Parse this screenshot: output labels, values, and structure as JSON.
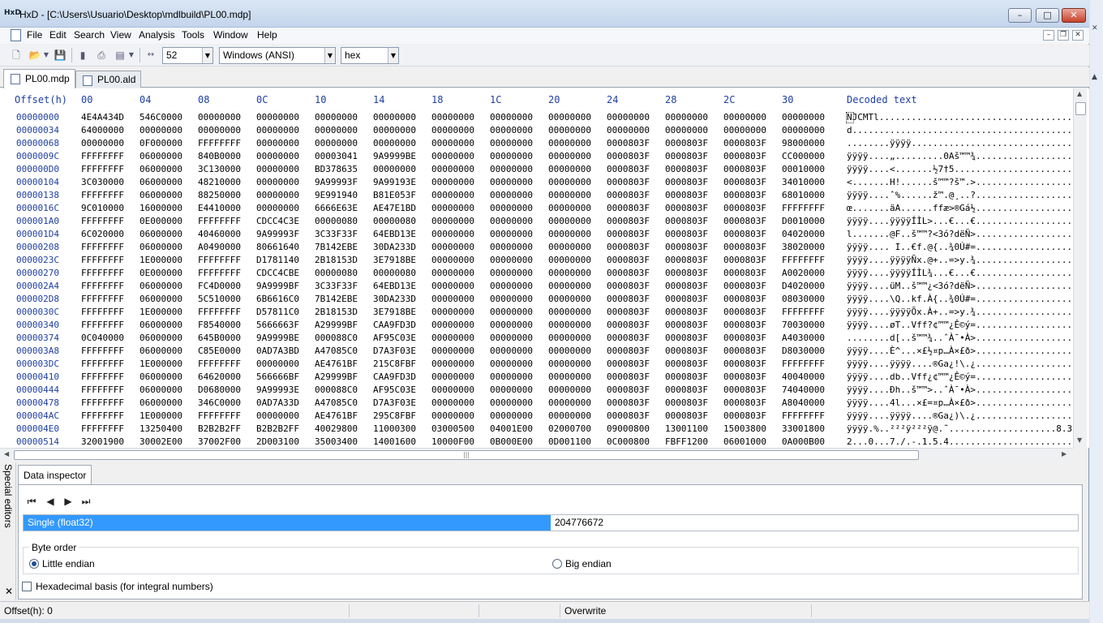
{
  "window": {
    "title": "HxD - [C:\\Users\\Usuario\\Desktop\\mdlbuild\\PL00.mdp]",
    "app_icon_text": "HxD"
  },
  "menubar": {
    "items": [
      "File",
      "Edit",
      "Search",
      "View",
      "Analysis",
      "Tools",
      "Window",
      "Help"
    ]
  },
  "toolbar": {
    "bytes_per_row": "52",
    "charset": "Windows (ANSI)",
    "display_mode": "hex"
  },
  "tabs": [
    {
      "label": "PL00.mdp",
      "active": true
    },
    {
      "label": "PL00.ald",
      "active": false
    }
  ],
  "hex_view": {
    "offset_header": "Offset(h)",
    "column_headers": [
      "00",
      "04",
      "08",
      "0C",
      "10",
      "14",
      "18",
      "1C",
      "20",
      "24",
      "28",
      "2C",
      "30"
    ],
    "decoded_header": "Decoded text",
    "rows": [
      {
        "offset": "00000000",
        "cells": [
          "4E4A434D",
          "546C0000",
          "00000000",
          "00000000",
          "00000000",
          "00000000",
          "00000000",
          "00000000",
          "00000000",
          "00000000",
          "00000000",
          "00000000",
          "00000000"
        ],
        "decoded": "NJCMTl......................................."
      },
      {
        "offset": "00000034",
        "cells": [
          "64000000",
          "00000000",
          "00000000",
          "00000000",
          "00000000",
          "00000000",
          "00000000",
          "00000000",
          "00000000",
          "00000000",
          "00000000",
          "00000000",
          "00000000"
        ],
        "decoded": "d............................................."
      },
      {
        "offset": "00000068",
        "cells": [
          "00000000",
          "0F000000",
          "FFFFFFFF",
          "00000000",
          "00000000",
          "00000000",
          "00000000",
          "00000000",
          "00000000",
          "0000803F",
          "0000803F",
          "0000803F",
          "98000000"
        ],
        "decoded": "........ÿÿÿÿ.................................."
      },
      {
        "offset": "0000009C",
        "cells": [
          "FFFFFFFF",
          "06000000",
          "840B0000",
          "00000000",
          "00003041",
          "9A9999BE",
          "00000000",
          "00000000",
          "00000000",
          "0000803F",
          "0000803F",
          "0000803F",
          "CC000000"
        ],
        "decoded": "ÿÿÿÿ....„.........0Aš™™¾........................"
      },
      {
        "offset": "000000D0",
        "cells": [
          "FFFFFFFF",
          "06000000",
          "3C130000",
          "00000000",
          "BD378635",
          "00000000",
          "00000000",
          "00000000",
          "00000000",
          "0000803F",
          "0000803F",
          "0000803F",
          "00010000"
        ],
        "decoded": "ÿÿÿÿ....<.......½7†5............................"
      },
      {
        "offset": "00000104",
        "cells": [
          "3C030000",
          "06000000",
          "48210000",
          "00000000",
          "9A99993F",
          "9A99193E",
          "00000000",
          "00000000",
          "00000000",
          "0000803F",
          "0000803F",
          "0000803F",
          "34010000"
        ],
        "decoded": "<.......H!......š™™?š™.>......................."
      },
      {
        "offset": "00000138",
        "cells": [
          "FFFFFFFF",
          "06000000",
          "88250000",
          "00000000",
          "9E991940",
          "B81E053F",
          "00000000",
          "00000000",
          "00000000",
          "0000803F",
          "0000803F",
          "0000803F",
          "68010000"
        ],
        "decoded": "ÿÿÿÿ....ˆ%......ž™.@¸..?......................."
      },
      {
        "offset": "0000016C",
        "cells": [
          "9C010000",
          "16000000",
          "E4410000",
          "00000000",
          "6666E63E",
          "AE47E1BD",
          "00000000",
          "00000000",
          "00000000",
          "0000803F",
          "0000803F",
          "0000803F",
          "FFFFFFFF"
        ],
        "decoded": "œ.......äA......ffæ>®Gá½........................"
      },
      {
        "offset": "000001A0",
        "cells": [
          "FFFFFFFF",
          "0E000000",
          "FFFFFFFF",
          "CDCC4C3E",
          "00000080",
          "00000080",
          "00000000",
          "00000000",
          "00000000",
          "0000803F",
          "0000803F",
          "0000803F",
          "D0010000"
        ],
        "decoded": "ÿÿÿÿ....ÿÿÿÿÍÌL>...€...€........................"
      },
      {
        "offset": "000001D4",
        "cells": [
          "6C020000",
          "06000000",
          "40460000",
          "9A99993F",
          "3C33F33F",
          "64EBD13E",
          "00000000",
          "00000000",
          "00000000",
          "0000803F",
          "0000803F",
          "0000803F",
          "04020000"
        ],
        "decoded": "l.......@F..š™™?<3ó?dëÑ>......................."
      },
      {
        "offset": "00000208",
        "cells": [
          "FFFFFFFF",
          "06000000",
          "A0490000",
          "80661640",
          "7B142EBE",
          "30DA233D",
          "00000000",
          "00000000",
          "00000000",
          "0000803F",
          "0000803F",
          "0000803F",
          "38020000"
        ],
        "decoded": "ÿÿÿÿ.... I..€f.@{..¾0Ú#=......................."
      },
      {
        "offset": "0000023C",
        "cells": [
          "FFFFFFFF",
          "1E000000",
          "FFFFFFFF",
          "D1781140",
          "2B18153D",
          "3E7918BE",
          "00000000",
          "00000000",
          "00000000",
          "0000803F",
          "0000803F",
          "0000803F",
          "FFFFFFFF"
        ],
        "decoded": "ÿÿÿÿ....ÿÿÿÿÑx.@+..=>y.¾........................"
      },
      {
        "offset": "00000270",
        "cells": [
          "FFFFFFFF",
          "0E000000",
          "FFFFFFFF",
          "CDCC4CBE",
          "00000080",
          "00000080",
          "00000000",
          "00000000",
          "00000000",
          "0000803F",
          "0000803F",
          "0000803F",
          "A0020000"
        ],
        "decoded": "ÿÿÿÿ....ÿÿÿÿÍÌL¾...€...€........................"
      },
      {
        "offset": "000002A4",
        "cells": [
          "FFFFFFFF",
          "06000000",
          "FC4D0000",
          "9A9999BF",
          "3C33F33F",
          "64EBD13E",
          "00000000",
          "00000000",
          "00000000",
          "0000803F",
          "0000803F",
          "0000803F",
          "D4020000"
        ],
        "decoded": "ÿÿÿÿ....üM..š™™¿<3ó?dëÑ>......................."
      },
      {
        "offset": "000002D8",
        "cells": [
          "FFFFFFFF",
          "06000000",
          "5C510000",
          "6B6616C0",
          "7B142EBE",
          "30DA233D",
          "00000000",
          "00000000",
          "00000000",
          "0000803F",
          "0000803F",
          "0000803F",
          "08030000"
        ],
        "decoded": "ÿÿÿÿ....\\Q..kf.À{..¾0Ú#=......................."
      },
      {
        "offset": "0000030C",
        "cells": [
          "FFFFFFFF",
          "1E000000",
          "FFFFFFFF",
          "D57811C0",
          "2B18153D",
          "3E7918BE",
          "00000000",
          "00000000",
          "00000000",
          "0000803F",
          "0000803F",
          "0000803F",
          "FFFFFFFF"
        ],
        "decoded": "ÿÿÿÿ....ÿÿÿÿÕx.À+..=>y.¾........................"
      },
      {
        "offset": "00000340",
        "cells": [
          "FFFFFFFF",
          "06000000",
          "F8540000",
          "5666663F",
          "A29999BF",
          "CAA9FD3D",
          "00000000",
          "00000000",
          "00000000",
          "0000803F",
          "0000803F",
          "0000803F",
          "70030000"
        ],
        "decoded": "ÿÿÿÿ....øT..Vff?¢™™¿Ê©ý=......................."
      },
      {
        "offset": "00000374",
        "cells": [
          "0C040000",
          "06000000",
          "645B0000",
          "9A9999BE",
          "000088C0",
          "AF95C03E",
          "00000000",
          "00000000",
          "00000000",
          "0000803F",
          "0000803F",
          "0000803F",
          "A4030000"
        ],
        "decoded": "........d[..š™™¾..ˆÀ¯•À>......................."
      },
      {
        "offset": "000003A8",
        "cells": [
          "FFFFFFFF",
          "06000000",
          "C85E0000",
          "0AD7A3BD",
          "A47085C0",
          "D7A3F03E",
          "00000000",
          "00000000",
          "00000000",
          "0000803F",
          "0000803F",
          "0000803F",
          "D8030000"
        ],
        "decoded": "ÿÿÿÿ....È^...×£½¤p…À×£ð>......................."
      },
      {
        "offset": "000003DC",
        "cells": [
          "FFFFFFFF",
          "1E000000",
          "FFFFFFFF",
          "00000000",
          "AE4761BF",
          "215C8FBF",
          "00000000",
          "00000000",
          "00000000",
          "0000803F",
          "0000803F",
          "0000803F",
          "FFFFFFFF"
        ],
        "decoded": "ÿÿÿÿ....ÿÿÿÿ....®Ga¿!\\.¿........................"
      },
      {
        "offset": "00000410",
        "cells": [
          "FFFFFFFF",
          "06000000",
          "64620000",
          "566666BF",
          "A29999BF",
          "CAA9FD3D",
          "00000000",
          "00000000",
          "00000000",
          "0000803F",
          "0000803F",
          "0000803F",
          "40040000"
        ],
        "decoded": "ÿÿÿÿ....db..Vff¿¢™™¿Ê©ý=......................."
      },
      {
        "offset": "00000444",
        "cells": [
          "FFFFFFFF",
          "06000000",
          "D0680000",
          "9A99993E",
          "000088C0",
          "AF95C03E",
          "00000000",
          "00000000",
          "00000000",
          "0000803F",
          "0000803F",
          "0000803F",
          "74040000"
        ],
        "decoded": "ÿÿÿÿ....Ðh..š™™>..ˆÀ¯•À>......................."
      },
      {
        "offset": "00000478",
        "cells": [
          "FFFFFFFF",
          "06000000",
          "346C0000",
          "0AD7A33D",
          "A47085C0",
          "D7A3F03E",
          "00000000",
          "00000000",
          "00000000",
          "0000803F",
          "0000803F",
          "0000803F",
          "A8040000"
        ],
        "decoded": "ÿÿÿÿ....4l...×£=¤p…À×£ð>......................."
      },
      {
        "offset": "000004AC",
        "cells": [
          "FFFFFFFF",
          "1E000000",
          "FFFFFFFF",
          "00000000",
          "AE4761BF",
          "295C8FBF",
          "00000000",
          "00000000",
          "00000000",
          "0000803F",
          "0000803F",
          "0000803F",
          "FFFFFFFF"
        ],
        "decoded": "ÿÿÿÿ....ÿÿÿÿ....®Ga¿)\\.¿........................"
      },
      {
        "offset": "000004E0",
        "cells": [
          "FFFFFFFF",
          "13250400",
          "B2B2B2FF",
          "B2B2B2FF",
          "40029800",
          "11000300",
          "03000500",
          "04001E00",
          "02000700",
          "09000800",
          "13001100",
          "15003800",
          "33001800"
        ],
        "decoded": "ÿÿÿÿ.%..²²²ÿ²²²ÿ@.˜....................8.3..."
      },
      {
        "offset": "00000514",
        "cells": [
          "32001900",
          "30002E00",
          "37002F00",
          "2D003100",
          "35003400",
          "14001600",
          "10000F00",
          "0B000E00",
          "0D001100",
          "0C000800",
          "FBFF1200",
          "06001000",
          "0A000B00"
        ],
        "decoded": "2...0...7./.-.1.5.4..........................."
      }
    ]
  },
  "special_editors": {
    "panel_label": "Special editors",
    "tab_label": "Data inspector",
    "data_type": "Single (float32)",
    "data_value": "204776672",
    "byte_order_label": "Byte order",
    "little_endian_label": "Little endian",
    "big_endian_label": "Big endian",
    "selected_byte_order": "Little endian",
    "hex_basis_label": "Hexadecimal basis (for integral numbers)",
    "hex_basis_checked": false
  },
  "statusbar": {
    "offset": "Offset(h): 0",
    "mode": "Overwrite"
  }
}
